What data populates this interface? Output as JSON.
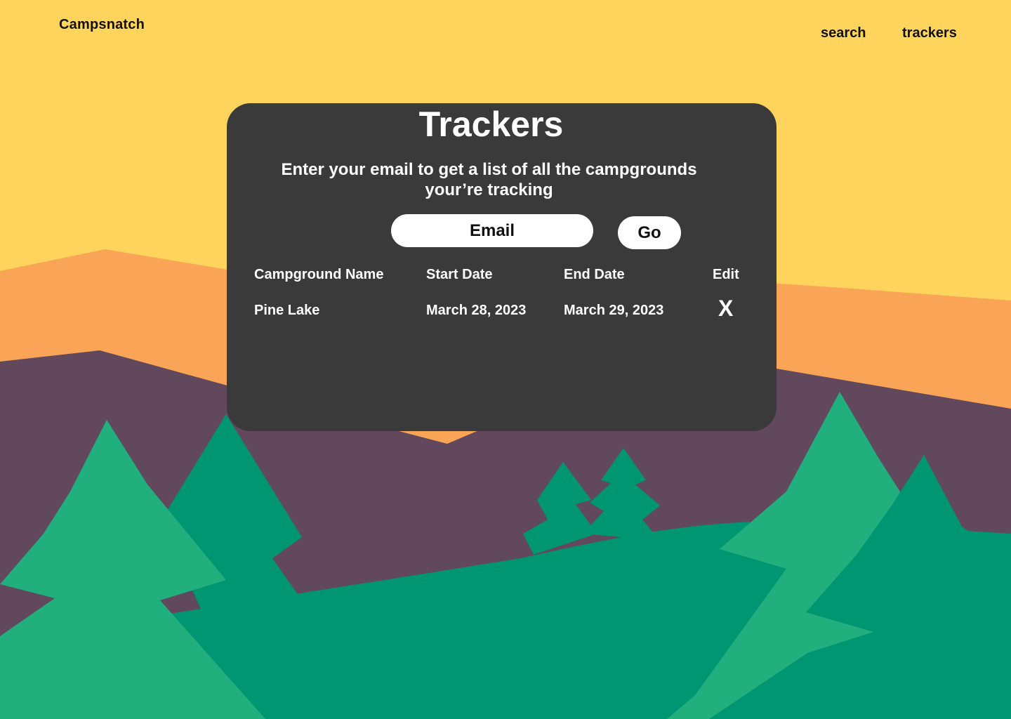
{
  "header": {
    "brand": "Campsnatch",
    "nav": [
      {
        "label": "search"
      },
      {
        "label": "trackers"
      }
    ]
  },
  "tracker_card": {
    "title": "Trackers",
    "subtitle_line1": "Enter your email to get a list of all the campgrounds",
    "subtitle_line2": "your’re tracking",
    "email_placeholder": "Email",
    "go_label": "Go",
    "table": {
      "headers": [
        "Campground Name",
        "Start Date",
        "End Date",
        "Edit"
      ],
      "rows": [
        {
          "name": "Pine Lake",
          "start": "March 28, 2023",
          "end": "March 29, 2023",
          "edit": "X"
        }
      ]
    }
  },
  "colors": {
    "sky": "#FFD45C",
    "mountain_far": "#F9A456",
    "mountain_near": "#61485C",
    "tree_light": "#21AF7E",
    "tree_dark": "#009672",
    "card": "#3A3A3A"
  },
  "icons": {
    "delete": "close-icon"
  }
}
